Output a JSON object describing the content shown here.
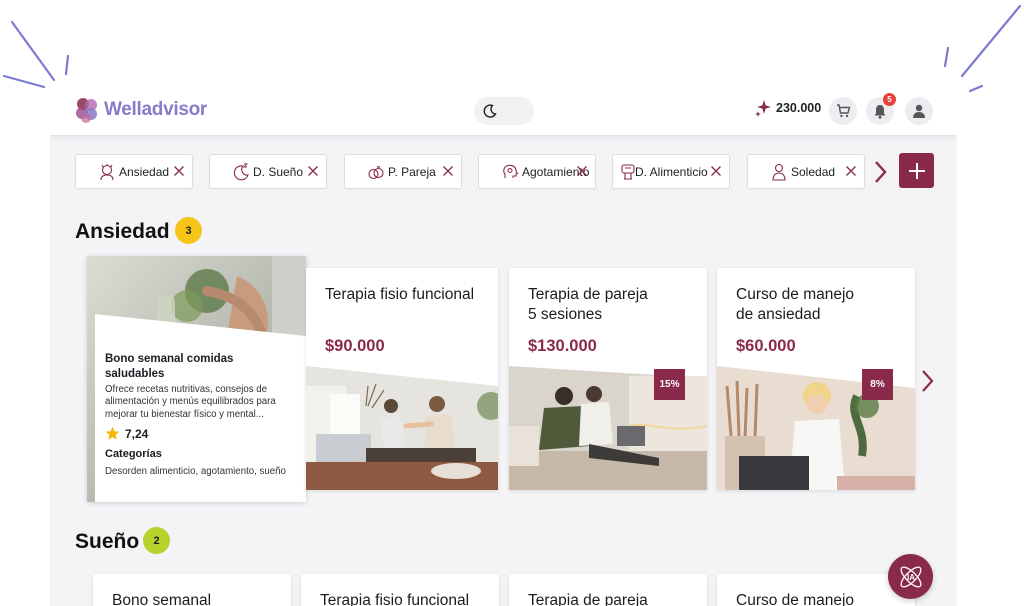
{
  "app": {
    "name": "Welladvisor"
  },
  "header": {
    "points": "230.000",
    "notifications_count": "5",
    "icons": [
      "moon-icon",
      "sparkle-icon",
      "cart-icon",
      "bell-icon",
      "user-icon"
    ]
  },
  "filters": [
    {
      "label": "Ansiedad",
      "icon": "anxiety-icon"
    },
    {
      "label": "D. Sueño",
      "icon": "sleep-icon"
    },
    {
      "label": "P. Pareja",
      "icon": "rings-icon"
    },
    {
      "label": "Agotamiento",
      "icon": "head-icon"
    },
    {
      "label": "D. Alimenticio",
      "icon": "food-icon"
    },
    {
      "label": "Soledad",
      "icon": "person-icon"
    }
  ],
  "sections": [
    {
      "title": "Ansiedad",
      "count": "3",
      "featured": {
        "title": "Bono semanal comidas saludables",
        "description": "Ofrece recetas nutritivas, consejos de alimentación y menús equilibrados para mejorar tu bienestar físico y mental...",
        "rating": "7,24",
        "categories_label": "Categorías",
        "categories": "Desorden alimenticio, agotamiento, sueño"
      },
      "cards": [
        {
          "title": "Terapia fisio funcional",
          "price": "$90.000",
          "discount": ""
        },
        {
          "title": "Terapia de pareja\n5 sesiones",
          "price": "$130.000",
          "discount": "15%"
        },
        {
          "title": "Curso de manejo\nde ansiedad",
          "price": "$60.000",
          "discount": "8%"
        }
      ]
    },
    {
      "title": "Sueño",
      "count": "2",
      "cards": [
        {
          "title": "Bono semanal"
        },
        {
          "title": "Terapia fisio funcional"
        },
        {
          "title": "Terapia de pareja"
        },
        {
          "title": "Curso de manejo"
        }
      ]
    }
  ],
  "colors": {
    "brand": "#8a2a4a",
    "logo": "#8a7ac8",
    "badge_yellow": "#f5c518",
    "badge_green": "#b5d32a",
    "notification": "#e8413c"
  },
  "fab": {
    "label": "IA"
  }
}
